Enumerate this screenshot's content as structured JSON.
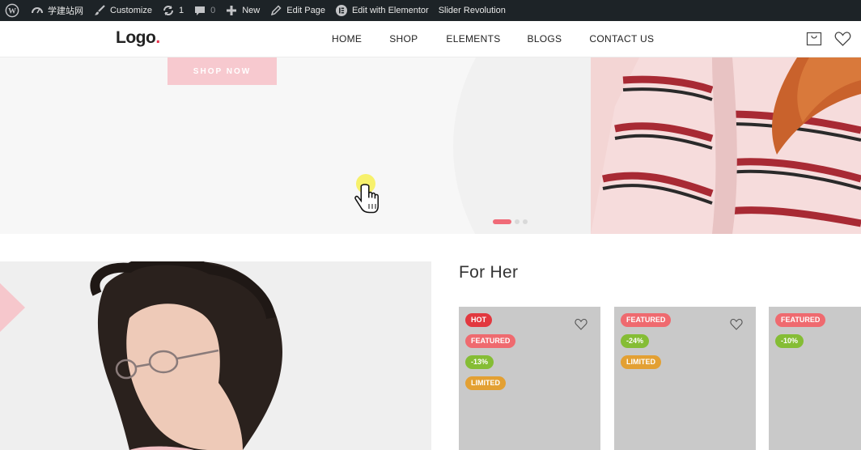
{
  "adminbar": {
    "site_name": "学建站网",
    "customize": "Customize",
    "updates_count": "1",
    "comments_count": "0",
    "new": "New",
    "edit_page": "Edit Page",
    "edit_elementor": "Edit with Elementor",
    "slider_revolution": "Slider Revolution"
  },
  "header": {
    "logo_text": "Logo",
    "logo_dot": ".",
    "nav": [
      "HOME",
      "SHOP",
      "ELEMENTS",
      "BLOGS",
      "CONTACT US"
    ]
  },
  "hero": {
    "button_label": "SHOP NOW",
    "active_slide": 1,
    "slide_count": 3
  },
  "section": {
    "title": "For Her"
  },
  "products": [
    {
      "badges": [
        "HOT",
        "FEATURED",
        "-13%",
        "LIMITED"
      ]
    },
    {
      "badges": [
        "FEATURED",
        "-24%",
        "LIMITED"
      ]
    },
    {
      "badges": [
        "FEATURED",
        "-10%"
      ]
    }
  ],
  "colors": {
    "accent": "#e8344e",
    "hot": "#e2383f",
    "featured": "#ef6a6f",
    "sale": "#85bd35",
    "limited": "#e3a033"
  }
}
